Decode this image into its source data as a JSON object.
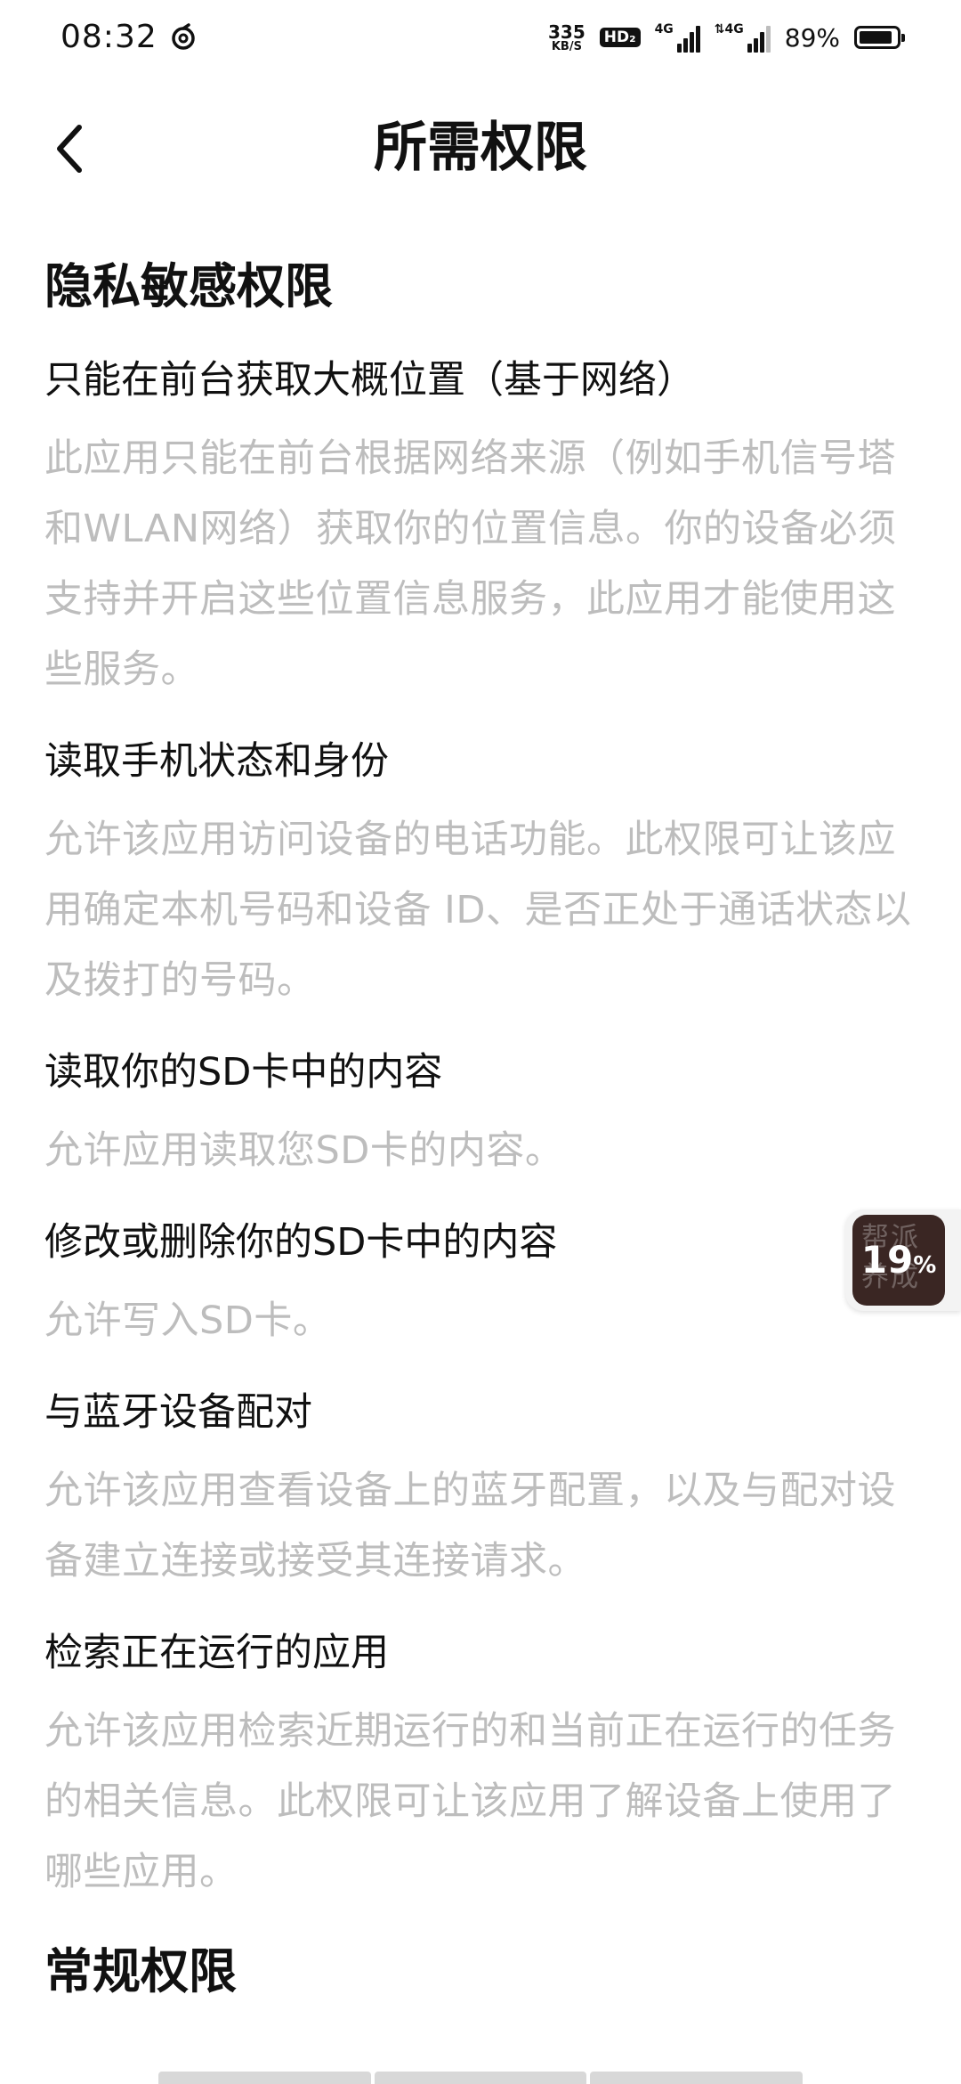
{
  "status_bar": {
    "time": "08:32",
    "net_speed_value": "335",
    "net_speed_unit": "KB/S",
    "hd_label": "HD₂",
    "signal1_label": "4G",
    "signal2_label": "⇅4G",
    "battery_percent": "89%",
    "battery_level": 0.89
  },
  "header": {
    "back_icon": "chevron-left-icon",
    "title": "所需权限"
  },
  "sections": {
    "privacy": {
      "title": "隐私敏感权限",
      "items": [
        {
          "title": "只能在前台获取大概位置（基于网络）",
          "desc": "此应用只能在前台根据网络来源（例如手机信号塔和WLAN网络）获取你的位置信息。你的设备必须支持并开启这些位置信息服务，此应用才能使用这些服务。"
        },
        {
          "title": "读取手机状态和身份",
          "desc": "允许该应用访问设备的电话功能。此权限可让该应用确定本机号码和设备 ID、是否正处于通话状态以及拨打的号码。"
        },
        {
          "title": "读取你的SD卡中的内容",
          "desc": "允许应用读取您SD卡的内容。"
        },
        {
          "title": "修改或删除你的SD卡中的内容",
          "desc": "允许写入SD卡。"
        },
        {
          "title": "与蓝牙设备配对",
          "desc": "允许该应用查看设备上的蓝牙配置，以及与配对设备建立连接或接受其连接请求。"
        },
        {
          "title": "检索正在运行的应用",
          "desc": "允许该应用检索近期运行的和当前正在运行的任务的相关信息。此权限可让该应用了解设备上使用了哪些应用。"
        }
      ]
    },
    "general": {
      "title": "常规权限"
    }
  },
  "float_widget": {
    "bg_text": "帮派养成",
    "percent_value": "19",
    "percent_sign": "%"
  },
  "colors": {
    "title_text": "#111111",
    "desc_text": "#bdbdbd",
    "widget_bg": "#3a2623"
  }
}
